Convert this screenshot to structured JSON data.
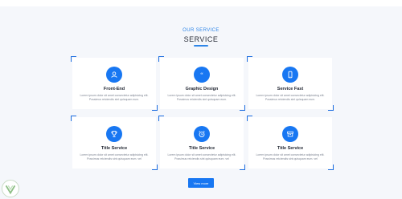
{
  "section": {
    "eyebrow": "OUR SERVICE",
    "title": "SERVICE"
  },
  "cards": [
    {
      "title": "Front-End",
      "text": "Lorem ipsum dolor sit amet consectetur adipisicing elit. Possimus reiciendis sint quisquam eum.",
      "icon": "user-icon"
    },
    {
      "title": "Graphic Design",
      "text": "Lorem ipsum dolor sit amet consectetur adipisicing elit. Possimus reiciendis sint quisquam eum.",
      "icon": "quote-icon"
    },
    {
      "title": "Service Fast",
      "text": "Lorem ipsum dolor sit amet consectetur adipisicing elit. Possimus reiciendis sint quisquam eum.",
      "icon": "phone-icon"
    },
    {
      "title": "Title Service",
      "text": "Lorem ipsum dolor sit amet consectetur adipisicing elit. Possimus reiciendis sint quisquam eum. vel",
      "icon": "trophy-icon"
    },
    {
      "title": "Title Service",
      "text": "Lorem ipsum dolor sit amet consectetur adipisicing elit. Possimus reiciendis sint quisquam eum. vel",
      "icon": "alarm-clock-icon"
    },
    {
      "title": "Title Service",
      "text": "Lorem ipsum dolor sit amet consectetur adipisicing elit. Possimus reiciendis sint quisquam eum. vel",
      "icon": "archive-box-icon"
    }
  ],
  "view_more_label": "View more",
  "colors": {
    "accent": "#1877f2",
    "corner": "#1f6fe0",
    "background": "#f5f7fb"
  }
}
